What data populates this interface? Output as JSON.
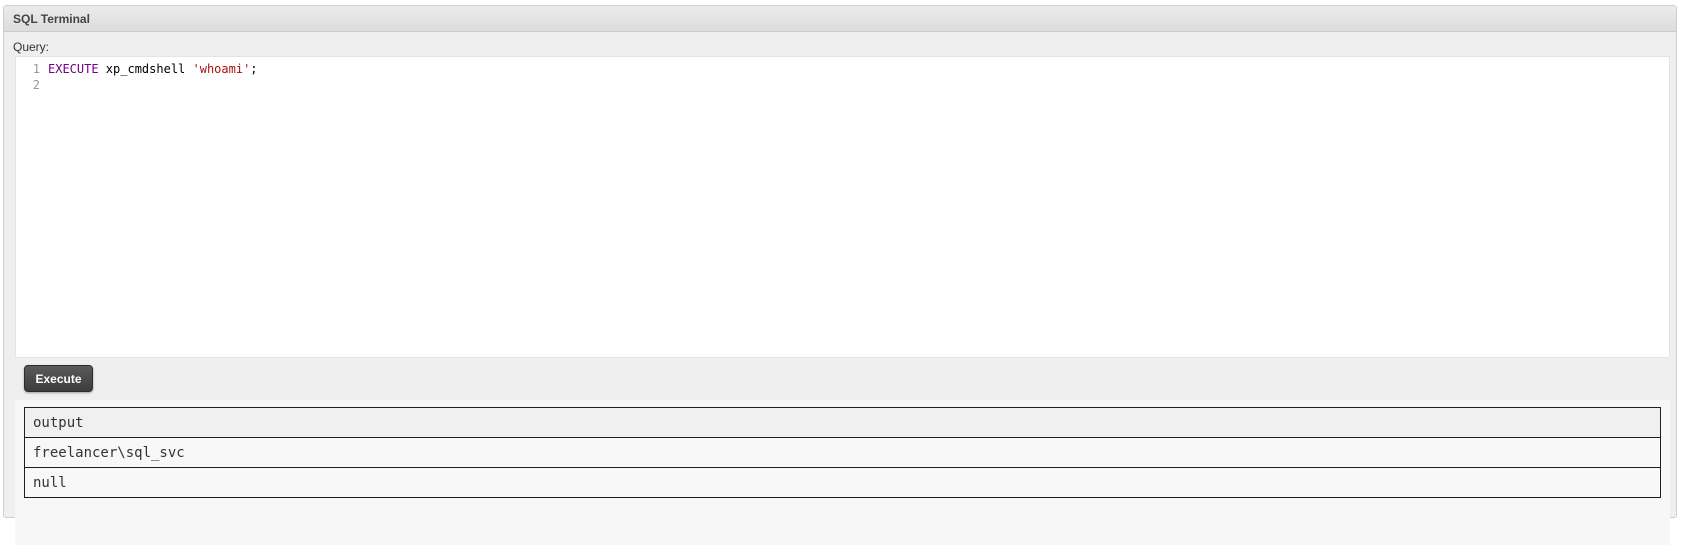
{
  "panel": {
    "title": "SQL Terminal"
  },
  "query": {
    "label": "Query:",
    "lines": [
      {
        "number": "1",
        "keyword": "EXECUTE",
        "text": " xp_cmdshell ",
        "string": "'whoami'",
        "end": ";"
      },
      {
        "number": "2",
        "keyword": "",
        "text": "",
        "string": "",
        "end": ""
      }
    ]
  },
  "execute_button": {
    "label": "Execute"
  },
  "results": {
    "header": "output",
    "rows": [
      "freelancer\\sql_svc",
      "null"
    ]
  },
  "colors": {
    "keyword": "#770088",
    "string": "#aa1111",
    "button": "#4a4a4a"
  }
}
